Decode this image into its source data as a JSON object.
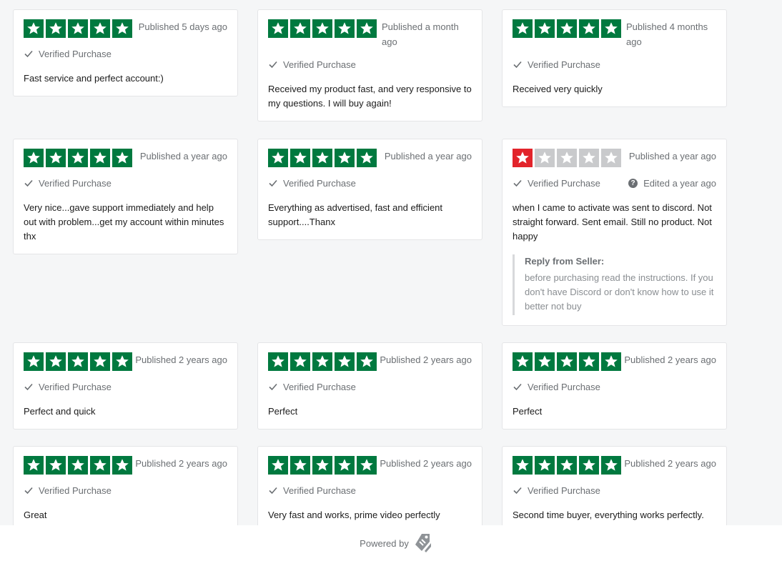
{
  "colors": {
    "star_green": "#00793f",
    "star_red": "#e2242b",
    "star_empty": "#c9cacc",
    "muted_text": "#6b6f73"
  },
  "verified_label": "Verified Purchase",
  "reviews": [
    {
      "rating": 5,
      "published": "Published 5 days ago",
      "text": "Fast service and perfect account:)"
    },
    {
      "rating": 5,
      "published": "Published a month ago",
      "text": "Received my product fast, and very responsive to my questions. I will buy again!"
    },
    {
      "rating": 5,
      "published": "Published 4 months ago",
      "text": "Received very quickly"
    },
    {
      "rating": 5,
      "published": "Published a year ago",
      "text": "Very nice...gave support immediately and help out with problem...get my account within minutes thx"
    },
    {
      "rating": 5,
      "published": "Published a year ago",
      "text": "Everything as advertised, fast and efficient support....Thanx"
    },
    {
      "rating": 1,
      "published": "Published a year ago",
      "edited": "Edited a year ago",
      "text": "when I came to activate was sent to discord. Not straight forward. Sent email. Still no product. Not happy",
      "reply": {
        "title": "Reply from Seller:",
        "text": "before purchasing read the instructions. If you don't have Discord or don't know how to use it better not buy"
      }
    },
    {
      "rating": 5,
      "published": "Published 2 years ago",
      "text": "Perfect and quick"
    },
    {
      "rating": 5,
      "published": "Published 2 years ago",
      "text": "Perfect"
    },
    {
      "rating": 5,
      "published": "Published 2 years ago",
      "text": "Perfect"
    },
    {
      "rating": 5,
      "published": "Published 2 years ago",
      "text": "Great"
    },
    {
      "rating": 5,
      "published": "Published 2 years ago",
      "text": "Very fast and works, prime video perfectly"
    },
    {
      "rating": 5,
      "published": "Published 2 years ago",
      "text": "Second time buyer, everything works perfectly."
    }
  ],
  "footer": {
    "powered_by": "Powered by",
    "logo_icon": "price-tag-icon"
  }
}
